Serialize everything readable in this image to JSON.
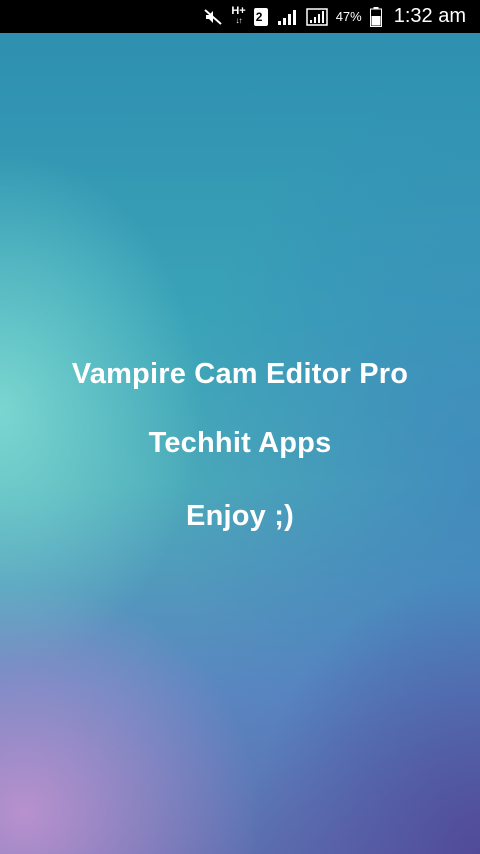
{
  "status_bar": {
    "network_type": "H+",
    "sim_slot": "2",
    "battery_percent": "47%",
    "time": "1:32 am",
    "icons": [
      "mute-icon",
      "data-arrows-icon",
      "sim-2-icon",
      "signal-icon",
      "signal-icon-2",
      "battery-icon"
    ]
  },
  "splash": {
    "app_name": "Vampire Cam Editor Pro",
    "developer": "Techhit Apps",
    "tagline": "Enjoy ;)"
  }
}
